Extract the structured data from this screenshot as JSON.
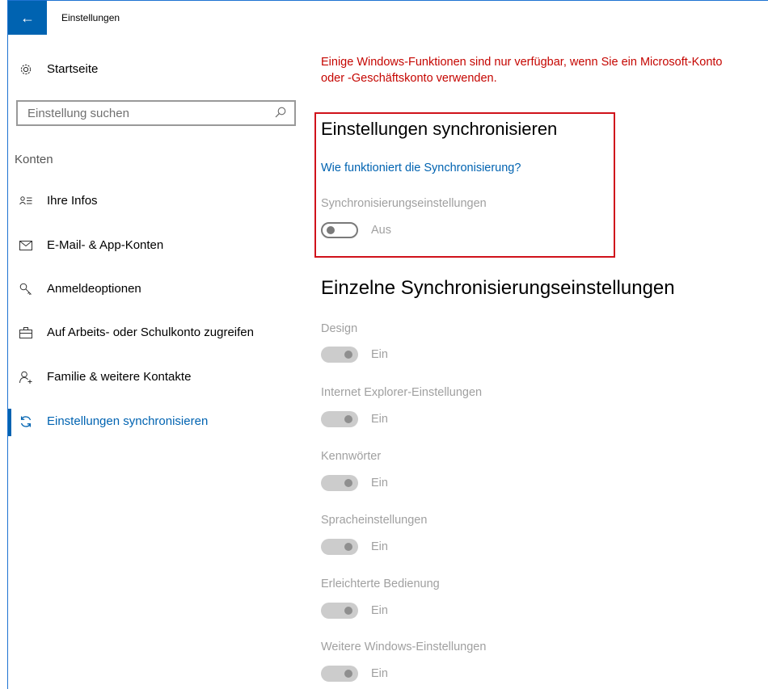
{
  "window": {
    "title": "Einstellungen",
    "accent_color": "#0063b1",
    "back_icon": "arrow-left-icon"
  },
  "sidebar": {
    "home_label": "Startseite",
    "home_icon": "gear-icon",
    "search_placeholder": "Einstellung suchen",
    "search_icon": "search-icon",
    "group_label": "Konten",
    "items": [
      {
        "label": "Ihre Infos",
        "icon": "person-list-icon",
        "active": false
      },
      {
        "label": "E-Mail- & App-Konten",
        "icon": "mail-icon",
        "active": false
      },
      {
        "label": "Anmeldeoptionen",
        "icon": "key-icon",
        "active": false
      },
      {
        "label": "Auf Arbeits- oder Schulkonto zugreifen",
        "icon": "briefcase-icon",
        "active": false
      },
      {
        "label": "Familie & weitere Kontakte",
        "icon": "person-add-icon",
        "active": false
      },
      {
        "label": "Einstellungen synchronisieren",
        "icon": "sync-icon",
        "active": true
      }
    ]
  },
  "main": {
    "warning": "Einige Windows-Funktionen sind nur verfügbar, wenn Sie ein Microsoft-Konto oder -Geschäftskonto verwenden.",
    "warning_color": "#c50500",
    "sync_section": {
      "title": "Einstellungen synchronisieren",
      "link": "Wie funktioniert die Synchronisierung?",
      "setting_label": "Synchronisierungseinstellungen",
      "toggle_state": "Aus"
    },
    "individual_section": {
      "title": "Einzelne Synchronisierungseinstellungen",
      "settings": [
        {
          "label": "Design",
          "state": "Ein"
        },
        {
          "label": "Internet Explorer-Einstellungen",
          "state": "Ein"
        },
        {
          "label": "Kennwörter",
          "state": "Ein"
        },
        {
          "label": "Spracheinstellungen",
          "state": "Ein"
        },
        {
          "label": "Erleichterte Bedienung",
          "state": "Ein"
        },
        {
          "label": "Weitere Windows-Einstellungen",
          "state": "Ein"
        }
      ]
    }
  }
}
